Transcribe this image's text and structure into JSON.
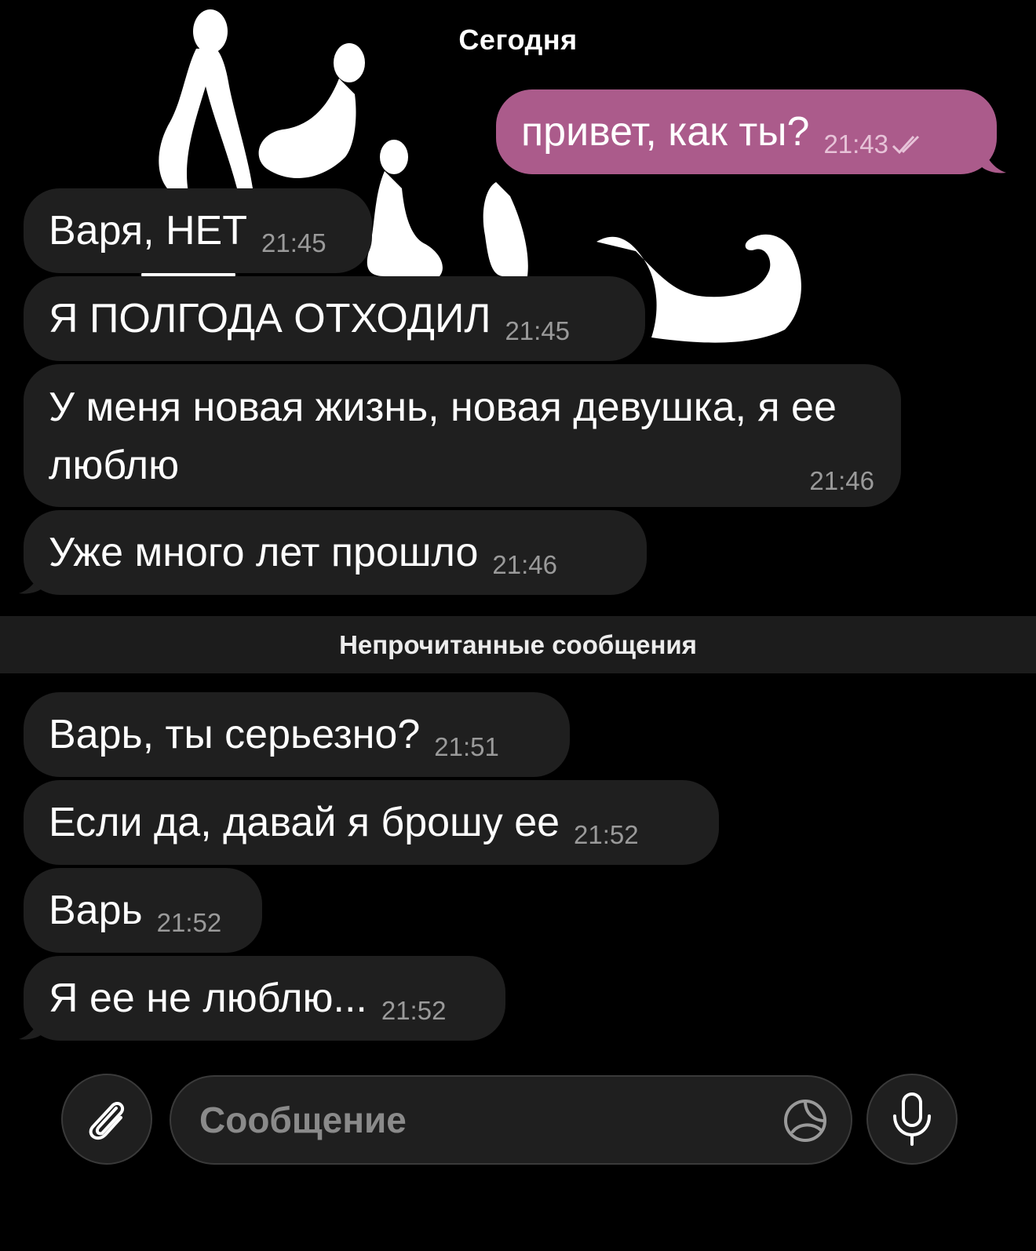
{
  "chat": {
    "date_label": "Сегодня",
    "unread_label": "Непрочитанные сообщения",
    "messages_before_unread": [
      {
        "direction": "out",
        "text": "привет, как ты?",
        "time": "21:43",
        "status": "read"
      },
      {
        "direction": "in",
        "text": "Варя, НЕТ",
        "time": "21:45"
      },
      {
        "direction": "in",
        "text": "Я ПОЛГОДА ОТХОДИЛ",
        "time": "21:45"
      },
      {
        "direction": "in",
        "text": "У меня новая жизнь, новая девушка, я ее люблю",
        "time": "21:46"
      },
      {
        "direction": "in",
        "text": "Уже много лет прошло",
        "time": "21:46"
      }
    ],
    "messages_after_unread": [
      {
        "direction": "in",
        "text": "Варь, ты серьезно?",
        "time": "21:51"
      },
      {
        "direction": "in",
        "text": "Если да, давай я брошу ее",
        "time": "21:52"
      },
      {
        "direction": "in",
        "text": "Варь",
        "time": "21:52"
      },
      {
        "direction": "in",
        "text": "Я ее не люблю...",
        "time": "21:52"
      }
    ]
  },
  "composer": {
    "placeholder": "Сообщение",
    "value": "",
    "attach_icon": "paperclip-icon",
    "sticker_icon": "sticker-icon",
    "mic_icon": "microphone-icon"
  },
  "colors": {
    "background": "#000000",
    "incoming_bubble": "#1f1f1f",
    "outgoing_bubble": "#ab5b8b",
    "timestamp": "#9a9a9a",
    "unread_bar": "#1c1c1c"
  }
}
